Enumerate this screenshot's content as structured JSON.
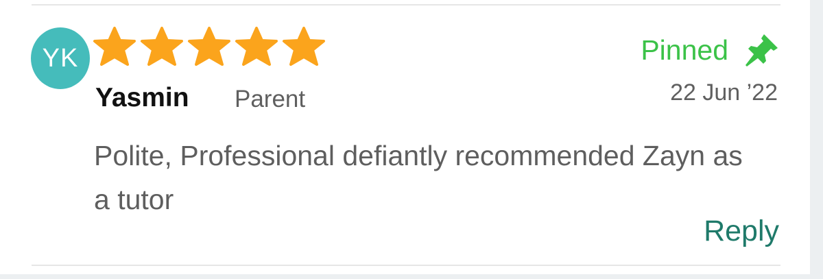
{
  "review": {
    "avatar_initials": "YK",
    "avatar_color": "#45bcbb",
    "rating": 5,
    "rating_max": 5,
    "star_color": "#fba41c",
    "author_name": "Yasmin",
    "author_role": "Parent",
    "pinned_label": "Pinned",
    "pinned_color": "#3bc248",
    "pin_icon": "pin-icon",
    "date": "22 Jun ’22",
    "text": "Polite, Professional defiantly recommended Zayn as a tutor",
    "reply_label": "Reply",
    "reply_color": "#1f7a6a"
  }
}
